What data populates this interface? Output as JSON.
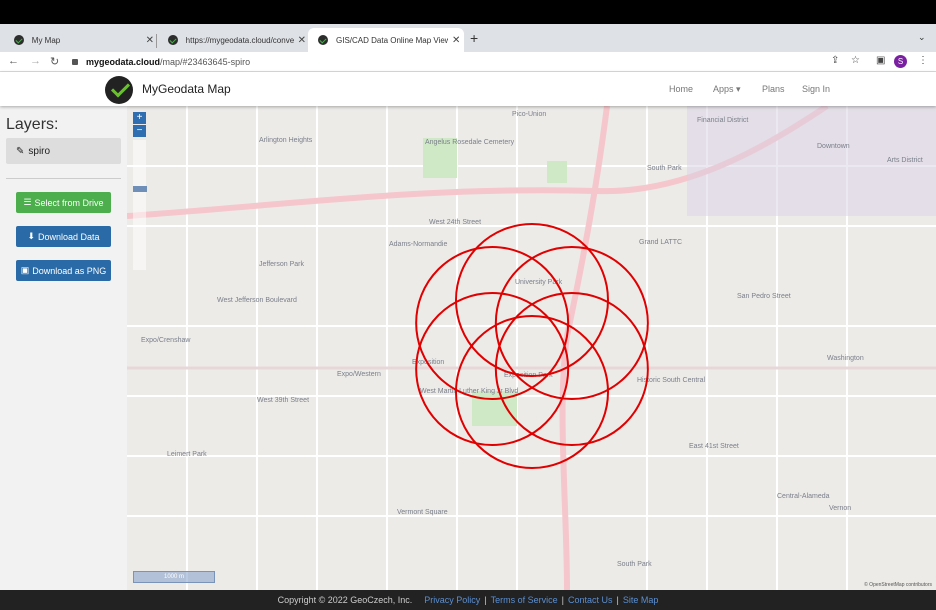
{
  "browser": {
    "tabs": [
      {
        "title": "My Map"
      },
      {
        "title": "https://mygeodata.cloud/conve"
      },
      {
        "title": "GIS/CAD Data Online Map Viewe"
      }
    ],
    "url_host": "mygeodata.cloud",
    "url_path": "/map/#23463645-spiro",
    "profile_initial": "S"
  },
  "site": {
    "brand": "MyGeodata Map",
    "nav": [
      "Home",
      "Apps",
      "Plans",
      "Sign In"
    ]
  },
  "sidebar": {
    "layers_heading": "Layers:",
    "layer_name": "spiro",
    "buttons": {
      "select": "Select from Drive",
      "download": "Download Data",
      "png": "Download as PNG"
    }
  },
  "map": {
    "zoom_in": "+",
    "zoom_out": "−",
    "scale": "1000 m",
    "attribution": "© OpenStreetMap contributors",
    "labels": [
      "Pico-Union",
      "Financial District",
      "Downtown",
      "Arts District",
      "Arlington Heights",
      "Angelus Rosedale Cemetery",
      "South Park",
      "West 24th Street",
      "Adams-Normandie",
      "Grand LATTC",
      "West Jefferson Boulevard",
      "Expo/Crenshaw",
      "Expo/Western",
      "West 39th Street",
      "Leimert Park",
      "Vermont Square",
      "South Park",
      "Central-Alameda",
      "Washington",
      "Historic South Central",
      "East 41st Street",
      "Vernon",
      "San Pedro Street",
      "Jefferson Park",
      "University Park",
      "Exposition",
      "West Martin Luther King Jr Blvd",
      "Exposition Park"
    ],
    "spiro_color": "#e00000"
  },
  "footer": {
    "copyright": "Copyright © 2022 GeoCzech, Inc.",
    "links": [
      "Privacy Policy",
      "Terms of Service",
      "Contact Us",
      "Site Map"
    ]
  }
}
